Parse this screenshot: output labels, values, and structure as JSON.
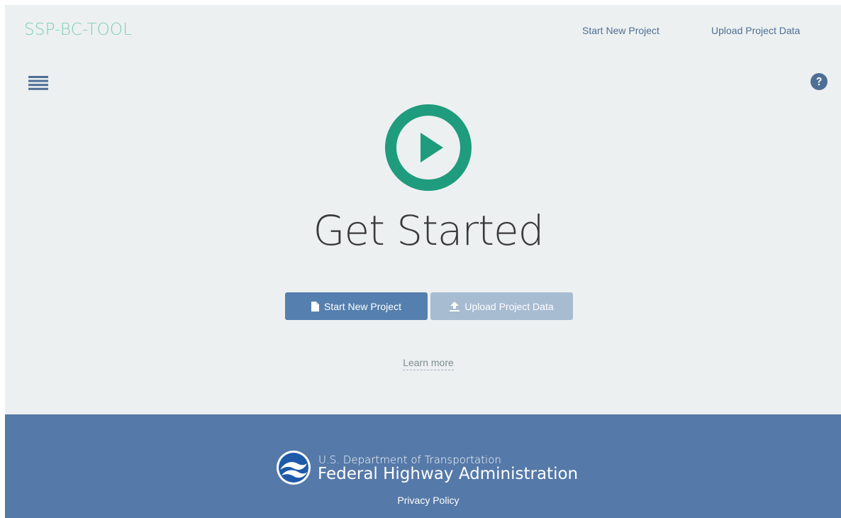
{
  "header": {
    "brand": "SSP-BC-TOOL",
    "nav": {
      "start_new_project": "Start New Project",
      "upload_project_data": "Upload Project Data"
    },
    "menu_icon": "hamburger-menu-icon",
    "help_icon": "question-circle-icon"
  },
  "hero": {
    "icon": "play-circle-icon",
    "title": "Get Started",
    "buttons": {
      "start_label": "Start New Project",
      "start_icon": "file-icon",
      "upload_label": "Upload Project Data",
      "upload_icon": "upload-icon"
    },
    "learn_more": "Learn more"
  },
  "footer": {
    "logo": "fhwa-logo",
    "department": "U.S. Department of Transportation",
    "agency": "Federal Highway Administration",
    "privacy_policy": "Privacy Policy"
  },
  "colors": {
    "background": "#ecf0f1",
    "brand": "#7fcfb4",
    "accent_teal": "#1f9c7d",
    "primary_button": "#557fae",
    "secondary_button": "#a7bbd1",
    "footer": "#5579a8",
    "nav_link": "#4e6f95"
  }
}
